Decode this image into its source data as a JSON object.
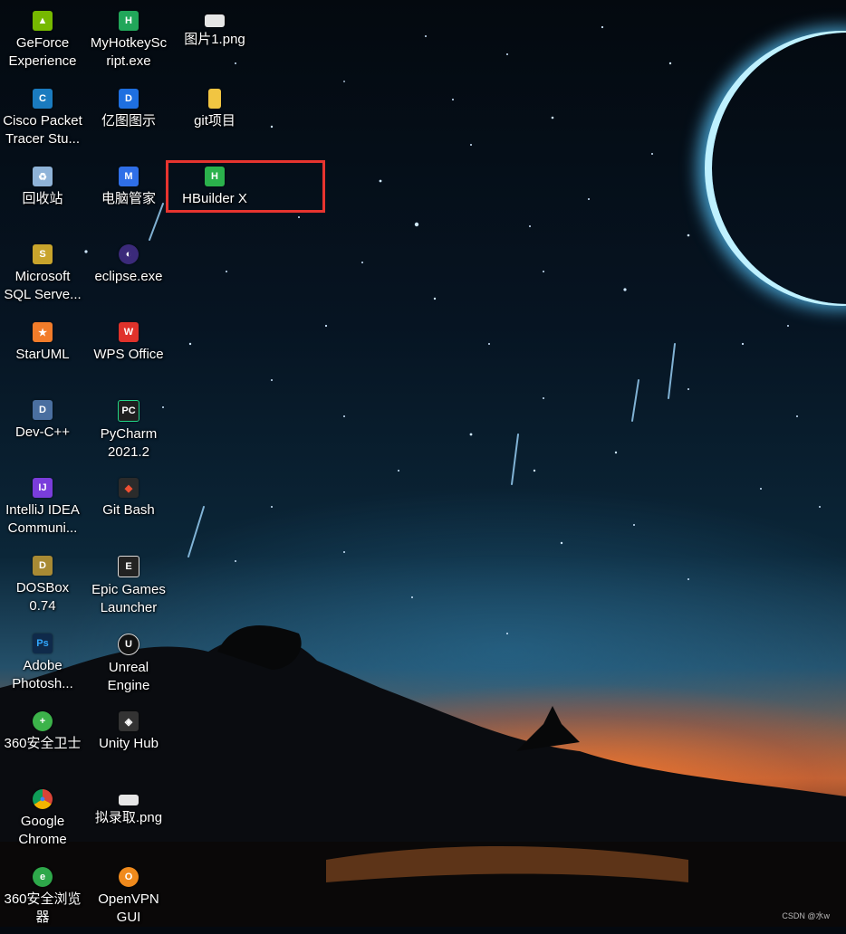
{
  "desktop": {
    "icons": [
      {
        "label": "GeForce\nExperience",
        "icon": "geforce-icon",
        "color": "#76b900",
        "glyph": "▲"
      },
      {
        "label": "MyHotkeySc\nript.exe",
        "icon": "hotkey-icon",
        "color": "#21a65a",
        "glyph": "H"
      },
      {
        "label": "图片1.png",
        "icon": "image-file-icon",
        "color": "#e6e6e6",
        "glyph": ""
      },
      {
        "label": "Cisco Packet\nTracer Stu...",
        "icon": "cisco-icon",
        "color": "#1a7bbf",
        "glyph": "C"
      },
      {
        "label": "亿图图示",
        "icon": "edraw-icon",
        "color": "#1e6fe0",
        "glyph": "D"
      },
      {
        "label": "git项目",
        "icon": "folder-icon",
        "color": "#f1c542",
        "glyph": ""
      },
      {
        "label": "回收站",
        "icon": "recycle-bin-icon",
        "color": "#8fb3d8",
        "glyph": "♻"
      },
      {
        "label": "电脑管家",
        "icon": "pc-manager-icon",
        "color": "#2f6fe8",
        "glyph": "M"
      },
      {
        "label": "HBuilder X",
        "icon": "hbuilder-icon",
        "color": "#2bb24c",
        "glyph": "H"
      },
      {
        "label": "Microsoft\nSQL Serve...",
        "icon": "sql-server-icon",
        "color": "#c8a42c",
        "glyph": "S"
      },
      {
        "label": "eclipse.exe",
        "icon": "eclipse-icon",
        "color": "#3b2a7a",
        "glyph": "◐"
      },
      {
        "label": "StarUML",
        "icon": "staruml-icon",
        "color": "#f27c2a",
        "glyph": "★"
      },
      {
        "label": "WPS Office",
        "icon": "wps-icon",
        "color": "#e0322b",
        "glyph": "W"
      },
      {
        "label": "Dev-C++",
        "icon": "devcpp-icon",
        "color": "#4a6fa0",
        "glyph": "D"
      },
      {
        "label": "PyCharm\n2021.2",
        "icon": "pycharm-icon",
        "color": "#1f1f1f",
        "glyph": "PC"
      },
      {
        "label": "IntelliJ IDEA\nCommuni...",
        "icon": "intellij-icon",
        "color": "#7a3ddb",
        "glyph": "IJ"
      },
      {
        "label": "Git Bash",
        "icon": "git-bash-icon",
        "color": "#2b2b2b",
        "glyph": "◆"
      },
      {
        "label": "DOSBox\n0.74",
        "icon": "dosbox-icon",
        "color": "#a88a34",
        "glyph": "D"
      },
      {
        "label": "Epic Games\nLauncher",
        "icon": "epic-games-icon",
        "color": "#222222",
        "glyph": "E"
      },
      {
        "label": "Adobe\nPhotosh...",
        "icon": "photoshop-icon",
        "color": "#0f2a4a",
        "glyph": "Ps"
      },
      {
        "label": "Unreal\nEngine",
        "icon": "unreal-icon",
        "color": "#111111",
        "glyph": "U"
      },
      {
        "label": "360安全卫士",
        "icon": "360-security-icon",
        "color": "#3cb34a",
        "glyph": "+"
      },
      {
        "label": "Unity Hub",
        "icon": "unity-icon",
        "color": "#333333",
        "glyph": "◈"
      },
      {
        "label": "Google\nChrome",
        "icon": "chrome-icon",
        "color": "#db4437",
        "glyph": "●"
      },
      {
        "label": "拟录取.png",
        "icon": "image-file-icon",
        "color": "#e6e6e6",
        "glyph": ""
      },
      {
        "label": "360安全浏览\n器",
        "icon": "360-browser-icon",
        "color": "#2ea84a",
        "glyph": "e"
      },
      {
        "label": "OpenVPN\nGUI",
        "icon": "openvpn-icon",
        "color": "#f08a1c",
        "glyph": "O"
      }
    ]
  },
  "watermark": "CSDN @水w"
}
